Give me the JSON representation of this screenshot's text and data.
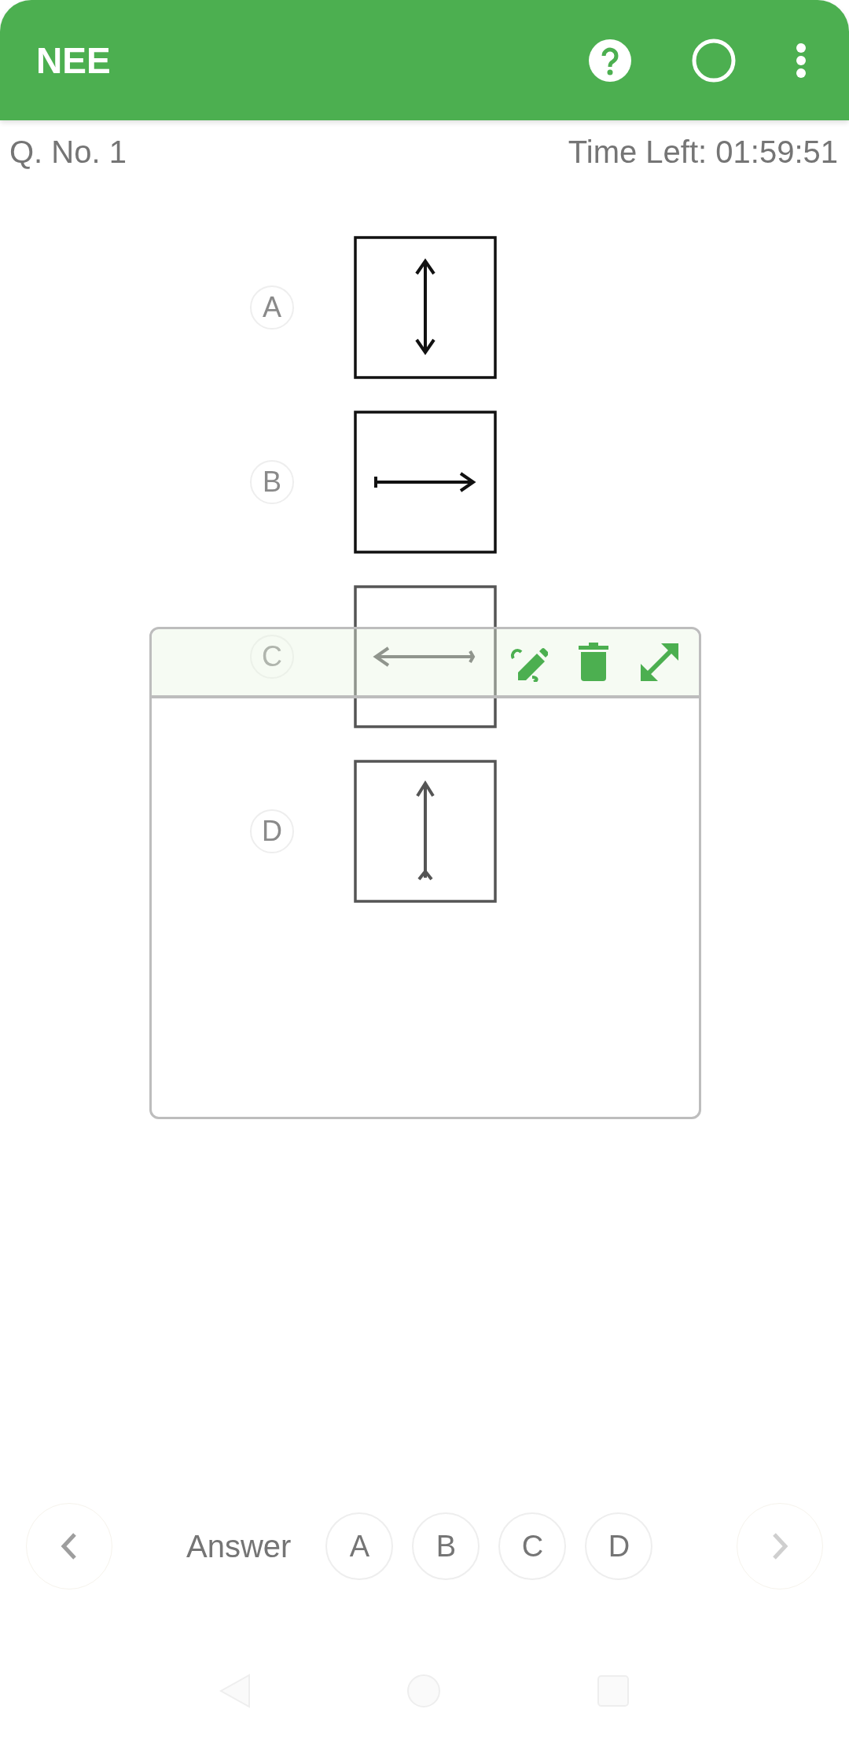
{
  "app_bar": {
    "title": "NEE"
  },
  "info": {
    "question_number": "Q. No. 1",
    "time_left": "Time Left: 01:59:51"
  },
  "options": [
    {
      "label": "A",
      "kind": "up-down"
    },
    {
      "label": "B",
      "kind": "right"
    },
    {
      "label": "C",
      "kind": "left"
    },
    {
      "label": "D",
      "kind": "up"
    }
  ],
  "answer_bar": {
    "label": "Answer",
    "choices": [
      {
        "label": "A",
        "selected": false
      },
      {
        "label": "B",
        "selected": false
      },
      {
        "label": "C",
        "selected": false
      },
      {
        "label": "D",
        "selected": false
      }
    ]
  }
}
